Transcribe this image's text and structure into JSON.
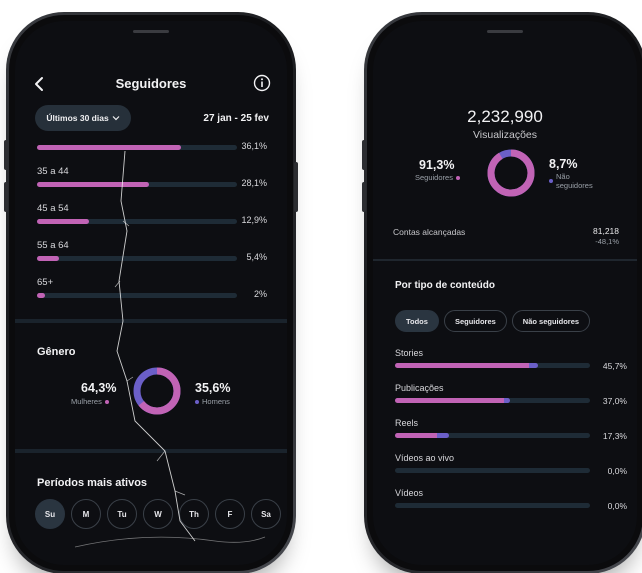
{
  "colors": {
    "accent_pink": "#c163b5",
    "accent_purple": "#6b5fc8",
    "track": "#1e2b36",
    "screen_bg": "#0d0e12"
  },
  "left": {
    "header": {
      "title": "Seguidores",
      "back_icon": "chevron-left-icon",
      "info_icon": "info-icon"
    },
    "period": {
      "selected": "Últimos 30 dias",
      "date_range": "27 jan - 25 fev"
    },
    "age_ranges": [
      {
        "label": "",
        "percent": 36.1,
        "text": "36,1%"
      },
      {
        "label": "35 a 44",
        "percent": 28.1,
        "text": "28,1%"
      },
      {
        "label": "45 a 54",
        "percent": 12.9,
        "text": "12,9%"
      },
      {
        "label": "55 a 64",
        "percent": 5.4,
        "text": "5,4%"
      },
      {
        "label": "65+",
        "percent": 2,
        "text": "2%"
      }
    ],
    "gender": {
      "title": "Gênero",
      "women_pct": "64,3%",
      "women_label": "Mulheres",
      "men_pct": "35,6%",
      "men_label": "Homens",
      "women_fraction": 0.643
    },
    "active_periods": {
      "title": "Períodos mais ativos",
      "days": [
        "Su",
        "M",
        "Tu",
        "W",
        "Th",
        "F",
        "Sa"
      ],
      "selected_index": 0
    }
  },
  "right": {
    "views": {
      "value": "2,232,990",
      "label": "Visualizações"
    },
    "split": {
      "followers_pct": "91,3%",
      "followers_label": "Seguidores",
      "non_followers_pct": "8,7%",
      "non_followers_label_1": "Não",
      "non_followers_label_2": "seguidores",
      "followers_fraction": 0.913
    },
    "reach": {
      "label": "Contas alcançadas",
      "value": "81,218",
      "delta": "-48,1%"
    },
    "content_type": {
      "title": "Por tipo de conteúdo",
      "filters": [
        "Todos",
        "Seguidores",
        "Não seguidores"
      ],
      "selected_filter": 0,
      "rows": [
        {
          "label": "Stories",
          "text": "45,7%",
          "followers": 43.0,
          "non_followers": 2.7
        },
        {
          "label": "Publicações",
          "text": "37,0%",
          "followers": 35.0,
          "non_followers": 2.0
        },
        {
          "label": "Reels",
          "text": "17,3%",
          "followers": 13.5,
          "non_followers": 3.8
        },
        {
          "label": "Vídeos ao vivo",
          "text": "0,0%",
          "followers": 0,
          "non_followers": 0
        },
        {
          "label": "Vídeos",
          "text": "0,0%",
          "followers": 0,
          "non_followers": 0
        }
      ]
    }
  }
}
